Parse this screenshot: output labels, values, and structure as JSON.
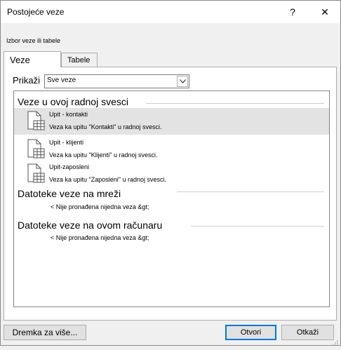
{
  "window": {
    "title": "Postojeće veze",
    "help_label": "?",
    "close_label": "✕"
  },
  "subtitle": "Izbor veze ili tabele",
  "tabs": [
    {
      "label": "Veze"
    },
    {
      "label": "Tabele"
    }
  ],
  "filter": {
    "label": "Prikaži",
    "selected": "Sve veze"
  },
  "groups": [
    {
      "title": "Veze u ovoj radnoj svesci",
      "items": [
        {
          "name": "Upit - kontakti",
          "description": "Veza ka upitu \"Kontakti\" u radnoj svesci.",
          "selected": true
        },
        {
          "name": "Upit - klijenti",
          "description": "Veza ka upitu \"Klijenti\" u radnoj svesci.",
          "selected": false
        },
        {
          "name": "Upit-zaposleni",
          "description": "Veza ka upitu \"Zaposleni\" u radnoj svesci.",
          "selected": false
        }
      ]
    },
    {
      "title": "Datoteke veze na mreži",
      "empty": "< Nije pronađena nijedna veza &gt;"
    },
    {
      "title": "Datoteke veze na ovom računaru",
      "empty": "< Nije pronađena nijedna veza &gt;"
    }
  ],
  "buttons": {
    "browse": "Dremka za više...",
    "open": "Otvori",
    "cancel": "Otkaži"
  },
  "icons": {
    "help": "question-mark-icon",
    "close": "close-icon",
    "connection": "connection-table-icon",
    "dropdown": "chevron-down-icon"
  }
}
